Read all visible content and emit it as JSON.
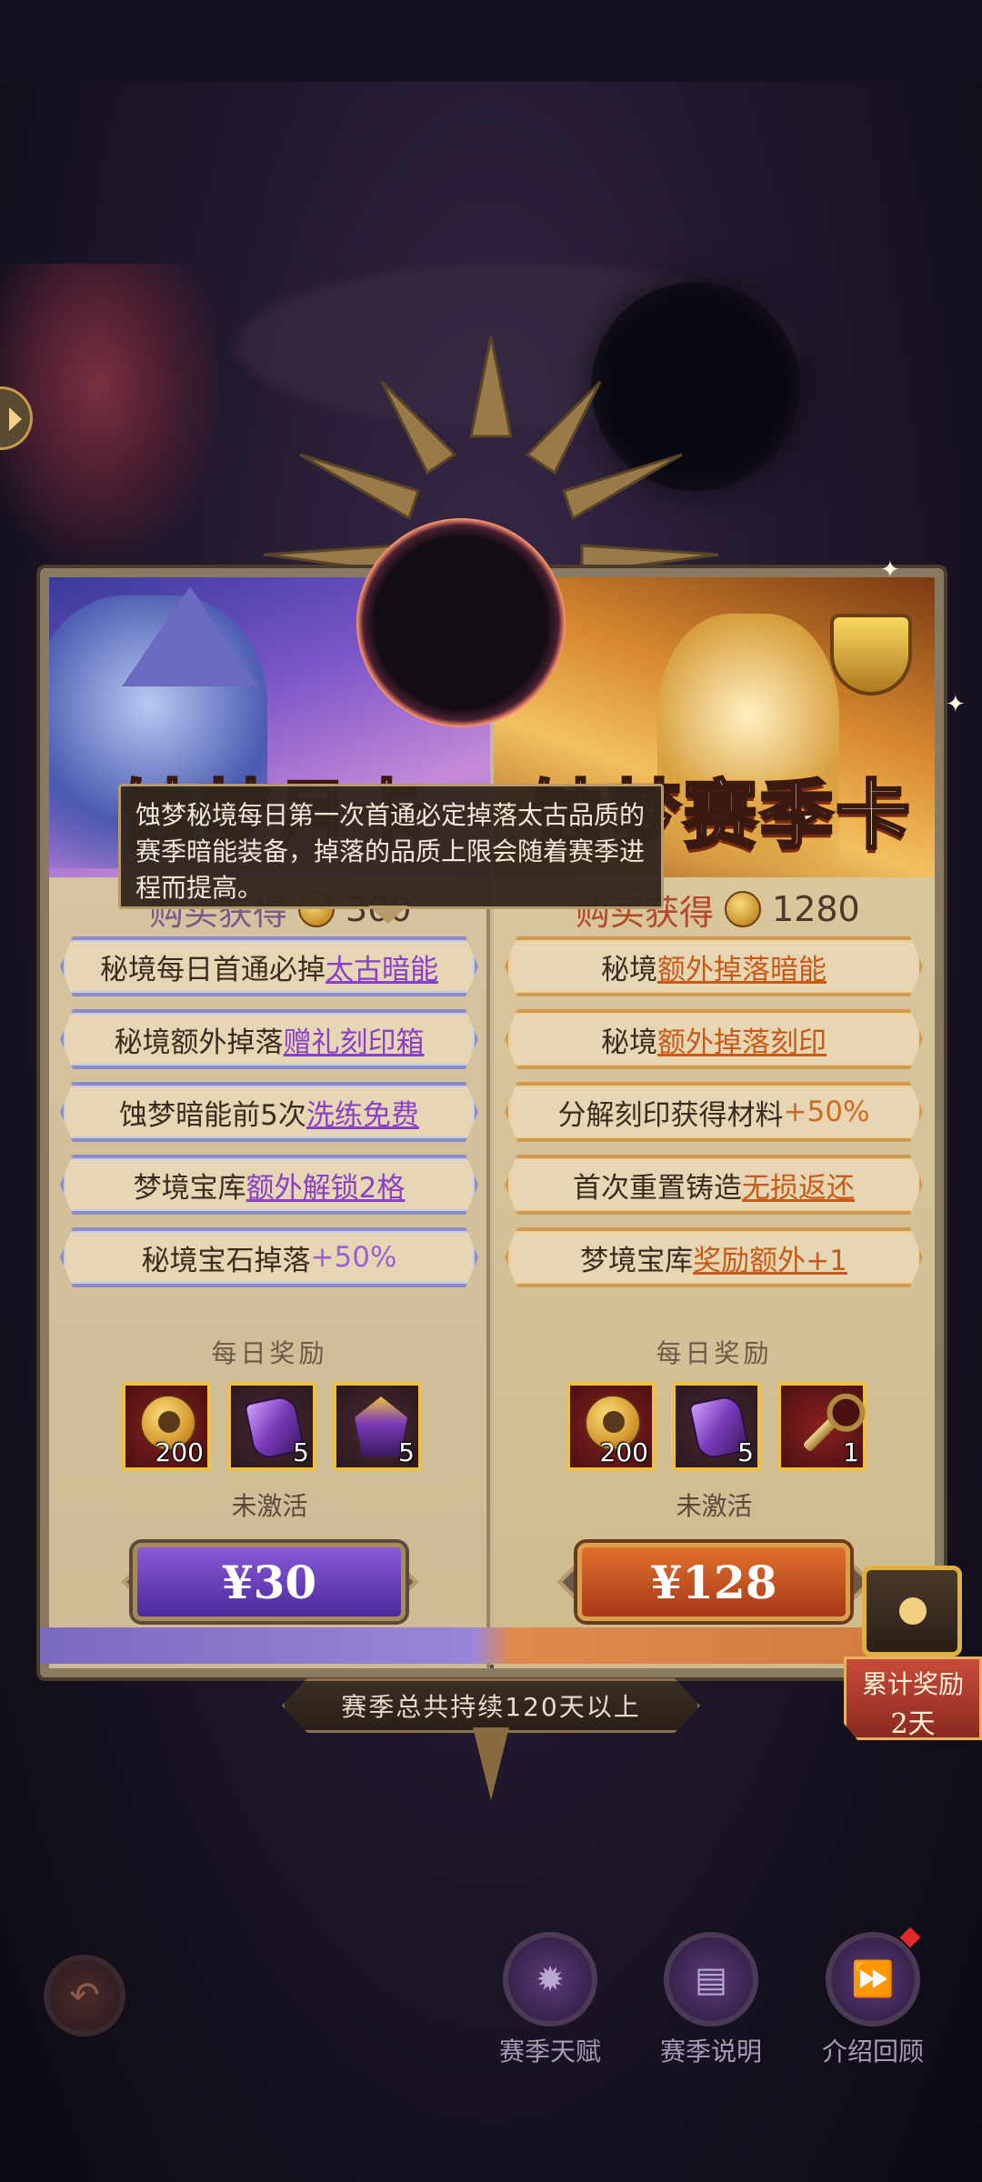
{
  "cards": {
    "left": {
      "title": "蚀梦月卡",
      "purchase_label": "购买获得",
      "purchase_amount": "300",
      "perks": [
        {
          "prefix": "秘境每日首通必掉",
          "highlight": "太古暗能"
        },
        {
          "prefix": "秘境额外掉落",
          "highlight": "赠礼刻印箱"
        },
        {
          "prefix": "蚀梦暗能前5次",
          "highlight": "洗练免费"
        },
        {
          "prefix": "梦境宝库",
          "highlight": "额外解锁2格"
        },
        {
          "prefix": "秘境宝石掉落",
          "highlight": "+50%"
        }
      ],
      "daily_rewards_label": "每日奖励",
      "rewards": [
        {
          "icon": "skull-coin-icon",
          "count": "200"
        },
        {
          "icon": "purple-rune-icon",
          "count": "5"
        },
        {
          "icon": "purple-potion-icon",
          "count": "5"
        }
      ],
      "status": "未激活",
      "price": "¥30"
    },
    "right": {
      "title": "蚀梦赛季卡",
      "purchase_label": "购买获得",
      "purchase_amount": "1280",
      "perks": [
        {
          "prefix": "秘境",
          "highlight": "额外掉落暗能"
        },
        {
          "prefix": "秘境",
          "highlight": "额外掉落刻印"
        },
        {
          "prefix": "分解刻印获得材料",
          "highlight": "+50%"
        },
        {
          "prefix": "首次重置铸造",
          "highlight": "无损返还"
        },
        {
          "prefix": "梦境宝库",
          "highlight": "奖励额外+1"
        }
      ],
      "daily_rewards_label": "每日奖励",
      "rewards": [
        {
          "icon": "skull-coin-icon",
          "count": "200"
        },
        {
          "icon": "purple-rune-icon",
          "count": "5"
        },
        {
          "icon": "golden-key-icon",
          "count": "1"
        }
      ],
      "status": "未激活",
      "price": "¥128"
    }
  },
  "tooltip": {
    "text": "蚀梦秘境每日第一次首通必定掉落太古品质的赛季暗能装备，掉落的品质上限会随着赛季进程而提高。"
  },
  "season_duration": "赛季总共持续120天以上",
  "accumulated_reward": {
    "label": "累计奖励",
    "days": "2天"
  },
  "nav": [
    {
      "label": "赛季天赋",
      "icon": "talent-icon"
    },
    {
      "label": "赛季说明",
      "icon": "document-icon"
    },
    {
      "label": "介绍回顾",
      "icon": "fast-forward-icon"
    }
  ],
  "colors": {
    "purple_accent": "#8a40c8",
    "orange_accent": "#c85a18",
    "gold": "#f0c040"
  }
}
